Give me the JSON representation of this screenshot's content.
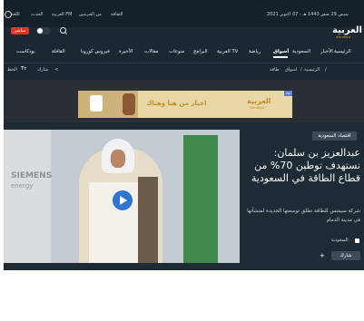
{
  "topbar": {
    "date": "الخميس 29 صفر 1443 هـ - 07 أكتوبر 2021",
    "links": [
      "الثقافة",
      "من الحرمين",
      "العربية FM",
      "الحدث",
      "اللغة"
    ],
    "logo": "العربية",
    "logo_sub": "alarabiya"
  },
  "live": {
    "label": "مباشر"
  },
  "nav": [
    "الرئيسية",
    "الأخبار",
    "السعودية",
    "أسواق",
    "رياضة",
    "العربية TV",
    "البرامج",
    "منوعات",
    "مقالات",
    "الأخيرة",
    "فيروس كورونا",
    "القافلة",
    "بودكاست"
  ],
  "breadcrumb": {
    "items": [
      "الرئيسية",
      "أسواق",
      "طاقة"
    ]
  },
  "secbar": {
    "share_label": "شارك",
    "font_label": "الخط"
  },
  "ad": {
    "ad_label": "Ad",
    "headline": "اخبار من هنا وهناك",
    "brand": "العربية",
    "brand_sub": "alarabiya"
  },
  "article": {
    "tag": "اقتصاد السعودية",
    "title": "عبدالعزيز بن سلمان: نستهدف توطين 70% من قطاع الطاقة في السعودية",
    "summary": "شركة سيمنس للطاقة تطلق توسعتها الجديدة لمنشأتها في مدينة الدمام",
    "source": "السعودية",
    "share_label": "شارك",
    "share_plus": "+",
    "sign_brand": "SIEMENS",
    "sign_sub": "energy"
  },
  "colors": {
    "topbar_bg": "#162028",
    "nav_bg": "#1b2731",
    "hero_bg": "#1e2b34",
    "live_red": "#e0342a",
    "ad_bg": "#e8d8a6",
    "ad_text": "#c78a2a"
  }
}
